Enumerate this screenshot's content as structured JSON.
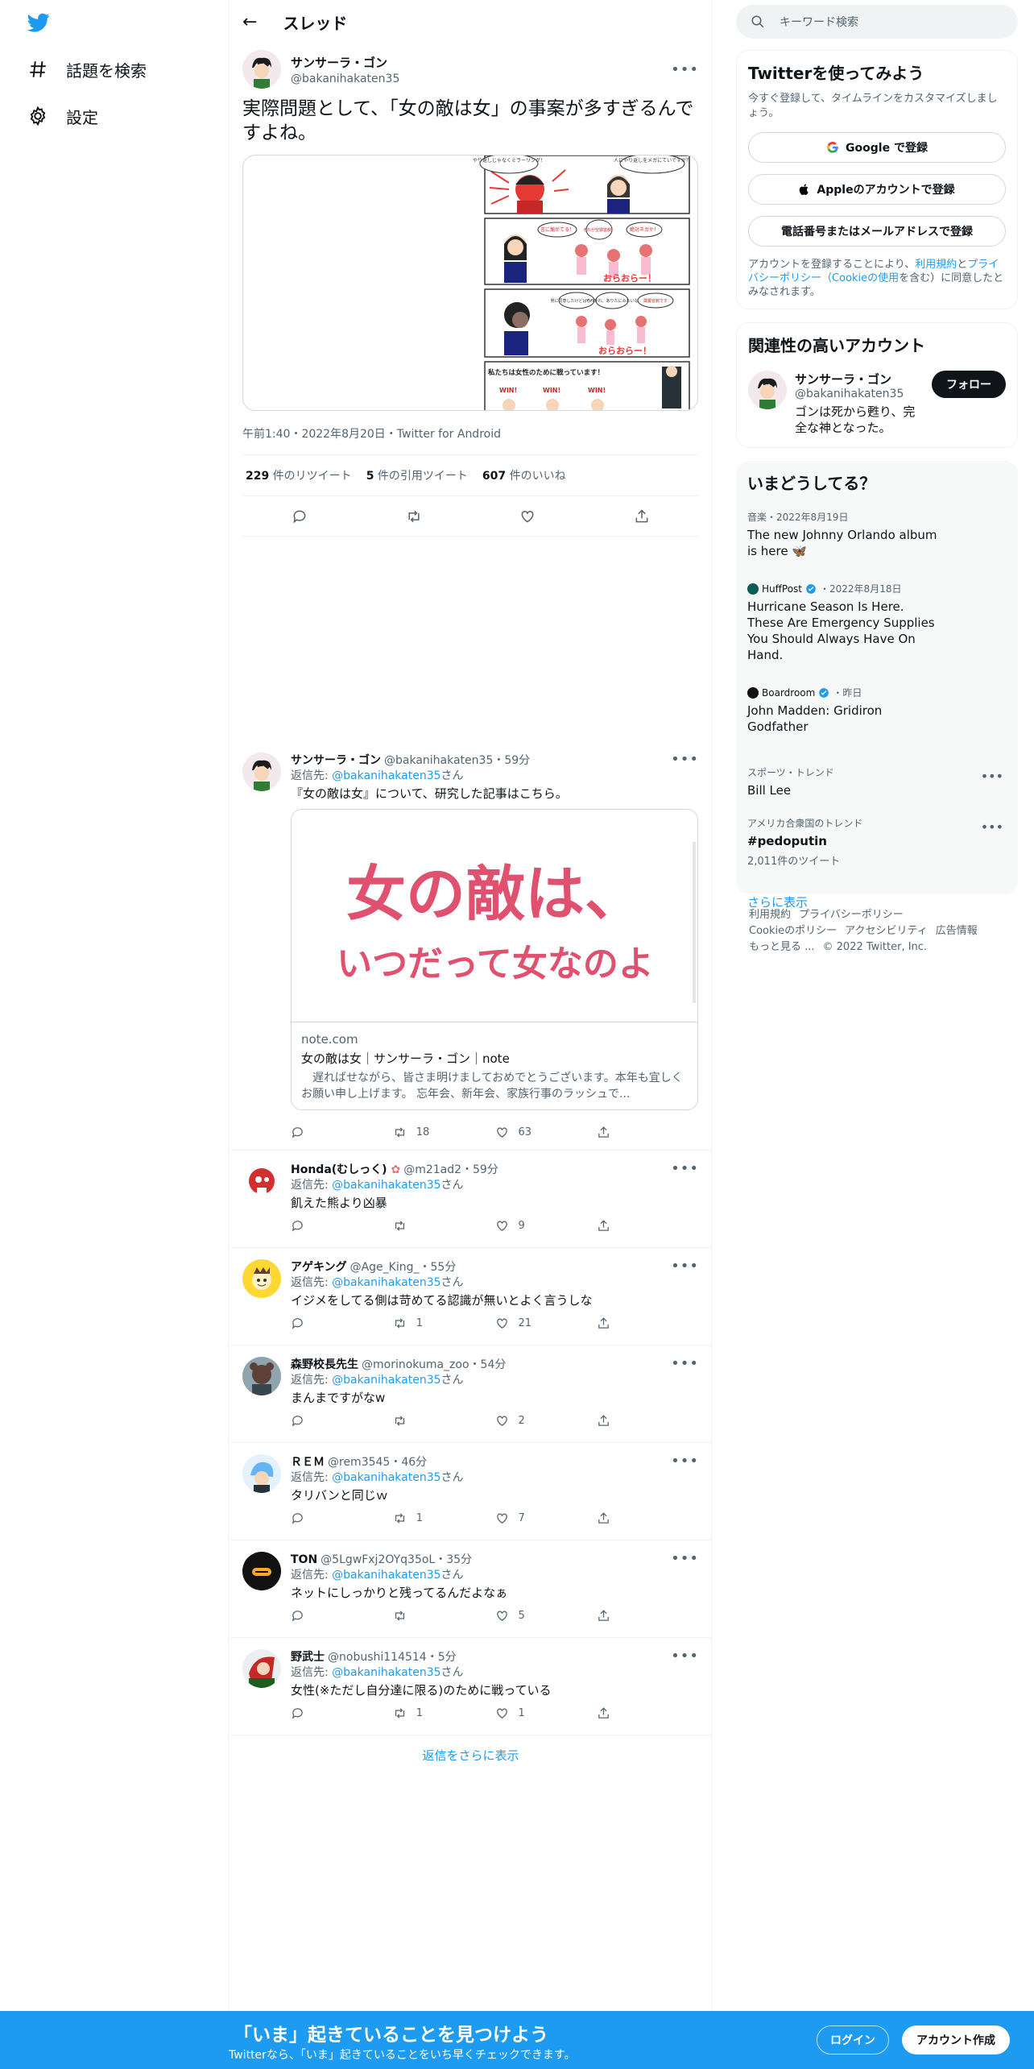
{
  "nav": {
    "explore_label": "話題を検索",
    "settings_label": "設定"
  },
  "header": {
    "title": "スレッド"
  },
  "main_tweet": {
    "name": "サンサーラ・ゴン",
    "handle": "@bakanihakaten35",
    "text": "実際問題として、「女の敵は女」の事案が多すぎるんですよね。",
    "meta": "午前1:40・2022年8月20日・Twitter for Android",
    "retweets_count": "229",
    "retweets_label": "件のリツイート",
    "quotes_count": "5",
    "quotes_label": "件の引用ツイート",
    "likes_count": "607",
    "likes_label": "件のいいね",
    "media_texts": {
      "bubble1": "やり返しじゃなくミラーリング！",
      "bubble2": "人にやり返しをメガにていですか？",
      "panel2_a": "言に煽がてる！",
      "panel2_b": "それが空罪容赦！",
      "panel2_c": "絶対ネガや！",
      "panel2_sfx": "おらおらー！",
      "panel3_a": "男に同意したけどはらべた？",
      "panel3_b": "やれやれ、ありたにみたいな",
      "panel3_c": "蔵慶容赦です",
      "panel3_sfx": "おらおらー！",
      "panel4": "私たちは女性のために戦っています！",
      "win": "WIN!"
    }
  },
  "replies": [
    {
      "name": "サンサーラ・ゴン",
      "handle_time": "@bakanihakaten35・59分",
      "reply_prefix": "返信先: ",
      "reply_to": "@bakanihakaten35",
      "reply_suffix": "さん",
      "text": "『女の敵は女』について、研究した記事はこちら。",
      "retweets": "18",
      "likes": "63",
      "card": {
        "image_line1": "女の敵は、",
        "image_line2": "いつだって女なのよ",
        "domain": "note.com",
        "title": "女の敵は女｜サンサーラ・ゴン｜note",
        "description": "　遅ればせながら、皆さま明けましておめでとうございます。本年も宜しくお願い申し上げます。 忘年会、新年会、家族行事のラッシュで..."
      }
    },
    {
      "name": "Honda(むしっく)",
      "handle_time": "@m21ad2・59分",
      "reply_prefix": "返信先: ",
      "reply_to": "@bakanihakaten35",
      "reply_suffix": "さん",
      "text": "飢えた熊より凶暴",
      "retweets": "",
      "likes": "9"
    },
    {
      "name": "アゲキング",
      "handle_time": "@Age_King_・55分",
      "reply_prefix": "返信先: ",
      "reply_to": "@bakanihakaten35",
      "reply_suffix": "さん",
      "text": "イジメをしてる側は苛めてる認識が無いとよく言うしな",
      "retweets": "1",
      "likes": "21"
    },
    {
      "name": "森野校長先生",
      "handle_time": "@morinokuma_zoo・54分",
      "reply_prefix": "返信先: ",
      "reply_to": "@bakanihakaten35",
      "reply_suffix": "さん",
      "text": "まんまですがなw",
      "retweets": "",
      "likes": "2"
    },
    {
      "name": "ＲＥＭ",
      "handle_time": "@rem3545・46分",
      "reply_prefix": "返信先: ",
      "reply_to": "@bakanihakaten35",
      "reply_suffix": "さん",
      "text": "タリバンと同じｗ",
      "retweets": "1",
      "likes": "7"
    },
    {
      "name": "TON",
      "handle_time": "@5LgwFxj2OYq35oL・35分",
      "reply_prefix": "返信先: ",
      "reply_to": "@bakanihakaten35",
      "reply_suffix": "さん",
      "text": "ネットにしっかりと残ってるんだよなぁ",
      "retweets": "",
      "likes": "5"
    },
    {
      "name": "野武士",
      "handle_time": "@nobushi114514・5分",
      "reply_prefix": "返信先: ",
      "reply_to": "@bakanihakaten35",
      "reply_suffix": "さん",
      "text": "女性(※ただし自分達に限る)のために戦っている",
      "retweets": "1",
      "likes": "1"
    }
  ],
  "show_more_replies": "返信をさらに表示",
  "search": {
    "placeholder": "キーワード検索"
  },
  "signup": {
    "title": "Twitterを使ってみよう",
    "subtitle": "今すぐ登録して、タイムラインをカスタマイズしましょう。",
    "google_label": "Google で登録",
    "apple_label": "Appleのアカウントで登録",
    "phone_label": "電話番号またはメールアドレスで登録",
    "terms_prefix": "アカウントを登録することにより、",
    "terms_link1": "利用規約",
    "terms_and": "と",
    "terms_link2": "プライバシーポリシー",
    "terms_paren_open": "（",
    "terms_link3": "Cookieの使用",
    "terms_suffix": "を含む）に同意したとみなされます。"
  },
  "relevant": {
    "title": "関連性の高いアカウント",
    "name": "サンサーラ・ゴン",
    "handle": "@bakanihakaten35",
    "bio": "ゴンは死から甦り、完全な神となった。",
    "follow_label": "フォロー"
  },
  "trends": {
    "title": "いまどうしてる？",
    "items": [
      {
        "category": "音楽・2022年8月19日",
        "title": "The new Johnny Orlando album is here 🦋"
      },
      {
        "publisher": "HuffPost",
        "category": "・2022年8月18日",
        "title": "Hurricane Season Is Here. These Are Emergency Supplies You Should Always Have On Hand."
      },
      {
        "publisher": "Boardroom",
        "category": "・昨日",
        "title": "John Madden: Gridiron Godfather"
      },
      {
        "category": "スポーツ・トレンド",
        "title": "Bill Lee"
      },
      {
        "category": "アメリカ合衆国のトレンド",
        "title": "#pedoputin",
        "count": "2,011件のツイート"
      }
    ],
    "show_more": "さらに表示"
  },
  "footer": {
    "terms": "利用規約",
    "privacy": "プライバシーポリシー",
    "cookie": "Cookieのポリシー",
    "accessibility": "アクセシビリティ",
    "ads": "広告情報",
    "more": "もっと見る ...",
    "copyright": "© 2022 Twitter, Inc."
  },
  "bottom_bar": {
    "title": "「いま」起きていることを見つけよう",
    "subtitle": "Twitterなら、「いま」起きていることをいち早くチェックできます。",
    "login_label": "ログイン",
    "signup_label": "アカウント作成"
  },
  "colors": {
    "accent": "#1d9bf0",
    "text": "#0f1419",
    "secondary": "#536471"
  }
}
